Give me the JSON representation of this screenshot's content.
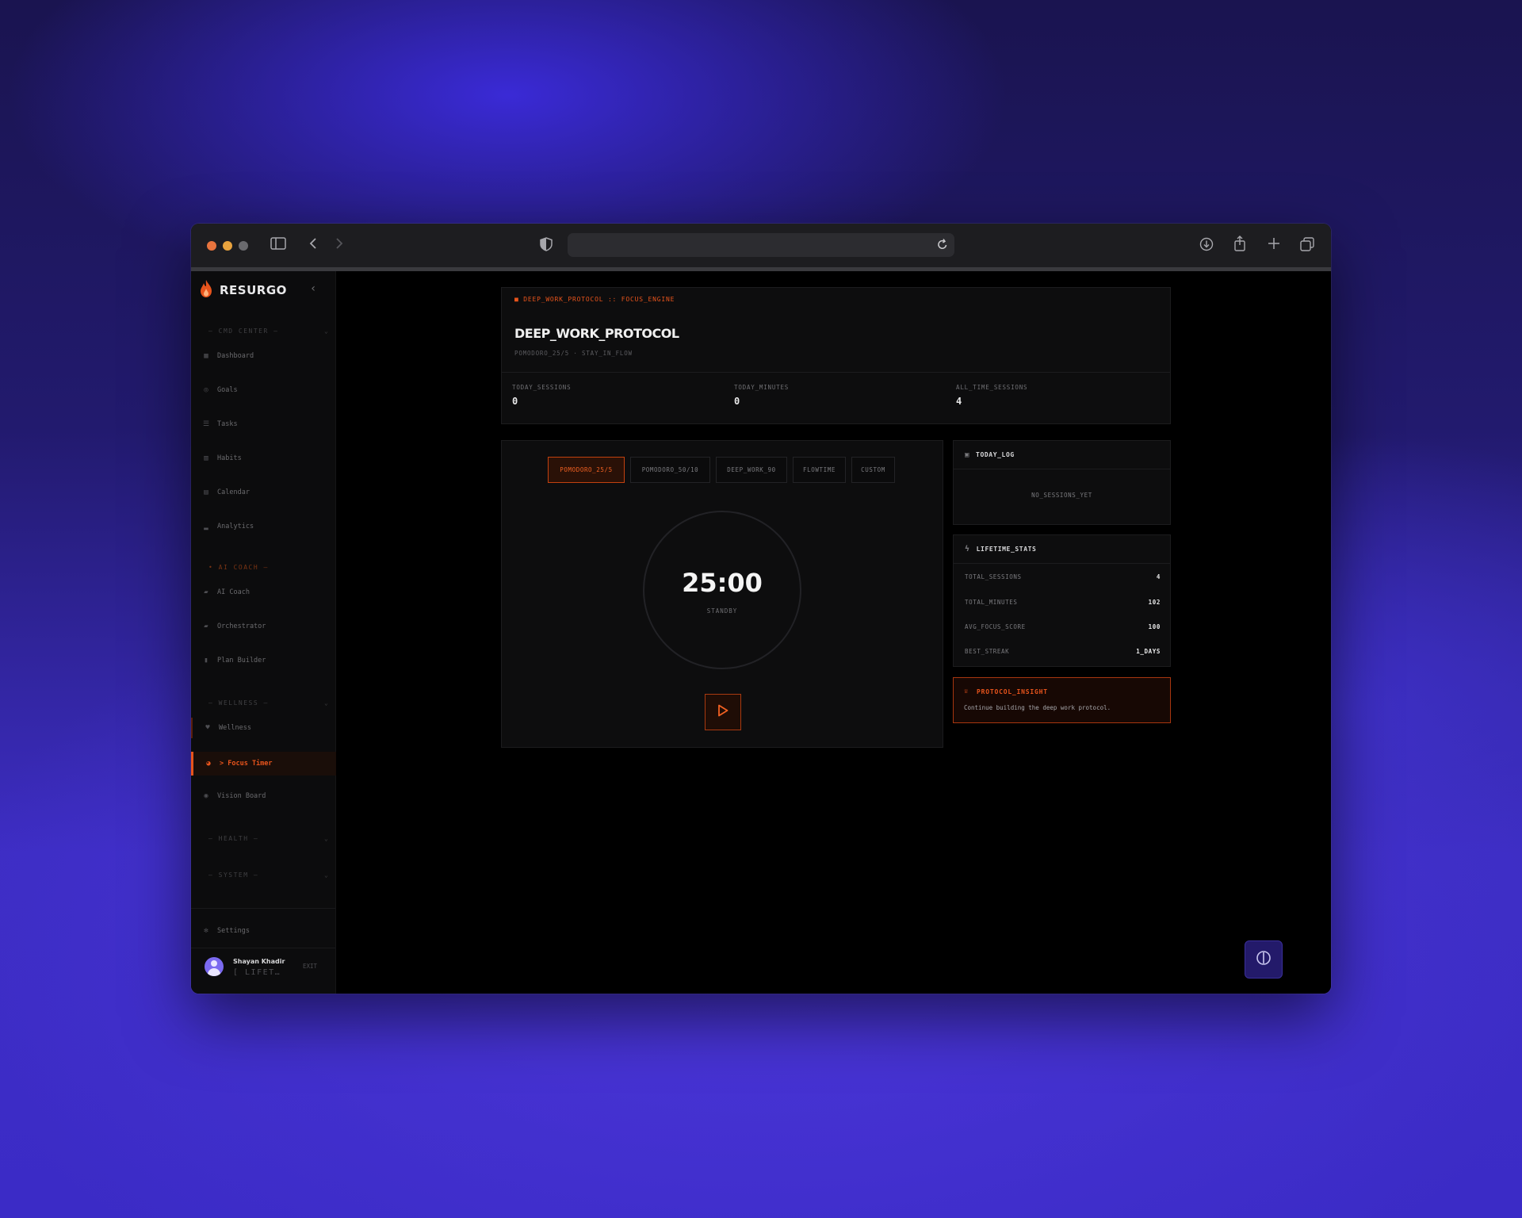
{
  "sidebar": {
    "brand": "RESURGO",
    "sections": {
      "cmd_center": "— CMD CENTER —",
      "ai_coach": "• AI COACH —",
      "wellness": "— WELLNESS —",
      "health": "— HEALTH —",
      "system": "— SYSTEM —"
    },
    "items": {
      "dashboard": "Dashboard",
      "goals": "Goals",
      "tasks": "Tasks",
      "habits": "Habits",
      "calendar": "Calendar",
      "analytics": "Analytics",
      "ai_coach": "AI Coach",
      "orchestrator": "Orchestrator",
      "plan_builder": "Plan Builder",
      "wellness": "Wellness",
      "focus_timer": "> Focus Timer",
      "vision_board": "Vision Board",
      "settings": "Settings"
    },
    "user": {
      "name": "Shayan Khadir",
      "plan": "[ LIFET…",
      "exit": "EXIT"
    }
  },
  "header": {
    "breadcrumb": "■ DEEP_WORK_PROTOCOL :: FOCUS_ENGINE",
    "title": "DEEP_WORK_PROTOCOL",
    "subtitle": "POMODORO_25/5 · STAY_IN_FLOW",
    "stats": {
      "today_sessions_label": "TODAY_SESSIONS",
      "today_sessions_value": "0",
      "today_minutes_label": "TODAY_MINUTES",
      "today_minutes_value": "0",
      "all_time_sessions_label": "ALL_TIME_SESSIONS",
      "all_time_sessions_value": "4"
    }
  },
  "timer": {
    "modes": [
      "POMODORO_25/5",
      "POMODORO_50/10",
      "DEEP_WORK_90",
      "FLOWTIME",
      "CUSTOM"
    ],
    "active_mode": 0,
    "time": "25:00",
    "state": "STANDBY"
  },
  "today_log": {
    "title": "TODAY_LOG",
    "empty": "NO_SESSIONS_YET"
  },
  "lifetime": {
    "title": "LIFETIME_STATS",
    "rows": [
      {
        "label": "TOTAL_SESSIONS",
        "value": "4"
      },
      {
        "label": "TOTAL_MINUTES",
        "value": "102"
      },
      {
        "label": "AVG_FOCUS_SCORE",
        "value": "100"
      },
      {
        "label": "BEST_STREAK",
        "value": "1_DAYS"
      }
    ]
  },
  "insight": {
    "title": "PROTOCOL_INSIGHT",
    "text": "Continue building the deep work protocol."
  },
  "colors": {
    "accent": "#e8541c",
    "background": "#000000",
    "panel": "#0d0d0e"
  }
}
